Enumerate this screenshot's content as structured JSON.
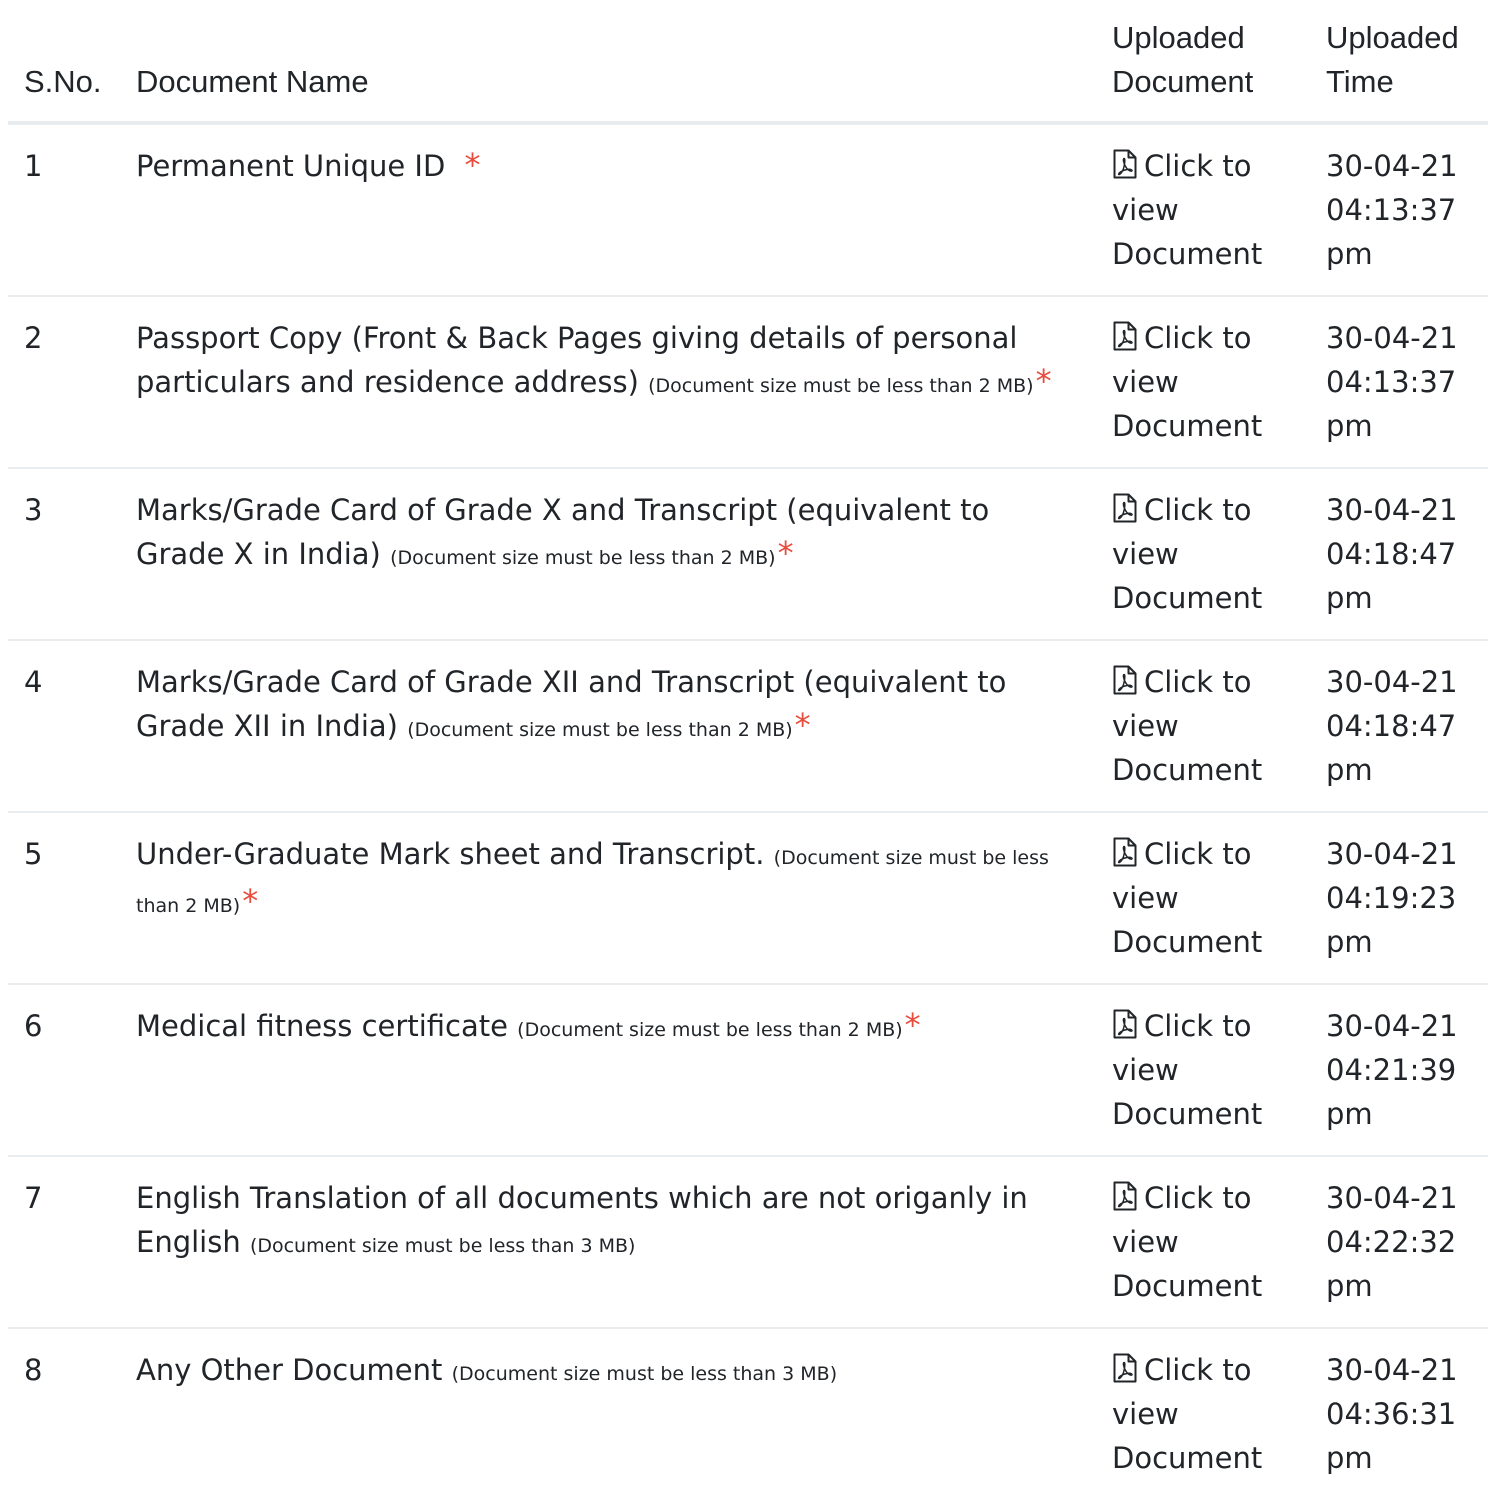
{
  "table": {
    "headers": {
      "sno": "S.No.",
      "name": "Document Name",
      "doc_line1": "Uploaded",
      "doc_line2": "Document",
      "time_line1": "Uploaded",
      "time_line2": "Time"
    },
    "rows": [
      {
        "sno": "1",
        "name": "Permanent Unique ID",
        "note": "",
        "required": "*",
        "link_label": "Click to view Document",
        "time_date": "30-04-21",
        "time_clock": "04:13:37",
        "time_ampm": "pm"
      },
      {
        "sno": "2",
        "name": "Passport Copy (Front & Back Pages giving details of personal particulars and residence address)",
        "note": "(Document size must be less than 2 MB)",
        "required": "*",
        "link_label": "Click to view Document",
        "time_date": "30-04-21",
        "time_clock": "04:13:37",
        "time_ampm": "pm"
      },
      {
        "sno": "3",
        "name": "Marks/Grade Card of Grade X and Transcript (equivalent to Grade X in India)",
        "note": "(Document size must be less than 2 MB)",
        "required": "*",
        "link_label": "Click to view Document",
        "time_date": "30-04-21",
        "time_clock": "04:18:47",
        "time_ampm": "pm"
      },
      {
        "sno": "4",
        "name": "Marks/Grade Card of Grade XII and Transcript (equivalent to Grade XII in India)",
        "note": "(Document size must be less than 2 MB)",
        "required": "*",
        "link_label": "Click to view Document",
        "time_date": "30-04-21",
        "time_clock": "04:18:47",
        "time_ampm": "pm"
      },
      {
        "sno": "5",
        "name": "Under-Graduate Mark sheet and Transcript.",
        "note": "(Document size must be less than 2 MB)",
        "required": "*",
        "link_label": "Click to view Document",
        "time_date": "30-04-21",
        "time_clock": "04:19:23",
        "time_ampm": "pm"
      },
      {
        "sno": "6",
        "name": "Medical fitness certificate",
        "note": "(Document size must be less than 2 MB)",
        "required": "*",
        "link_label": "Click to view Document",
        "time_date": "30-04-21",
        "time_clock": "04:21:39",
        "time_ampm": "pm"
      },
      {
        "sno": "7",
        "name": "English Translation of all documents which are not origanly in English",
        "note": "(Document size must be less than 3 MB)",
        "required": "",
        "link_label": "Click to view Document",
        "time_date": "30-04-21",
        "time_clock": "04:22:32",
        "time_ampm": "pm"
      },
      {
        "sno": "8",
        "name": "Any Other Document",
        "note": "(Document size must be less than 3 MB)",
        "required": "",
        "link_label": "Click to view Document",
        "time_date": "30-04-21",
        "time_clock": "04:36:31",
        "time_ampm": "pm"
      }
    ]
  },
  "icons": {
    "view_link": "pdf-file-icon"
  },
  "colors": {
    "required_star": "#e74c3c",
    "text": "#212529",
    "divider": "#e9ecef"
  }
}
